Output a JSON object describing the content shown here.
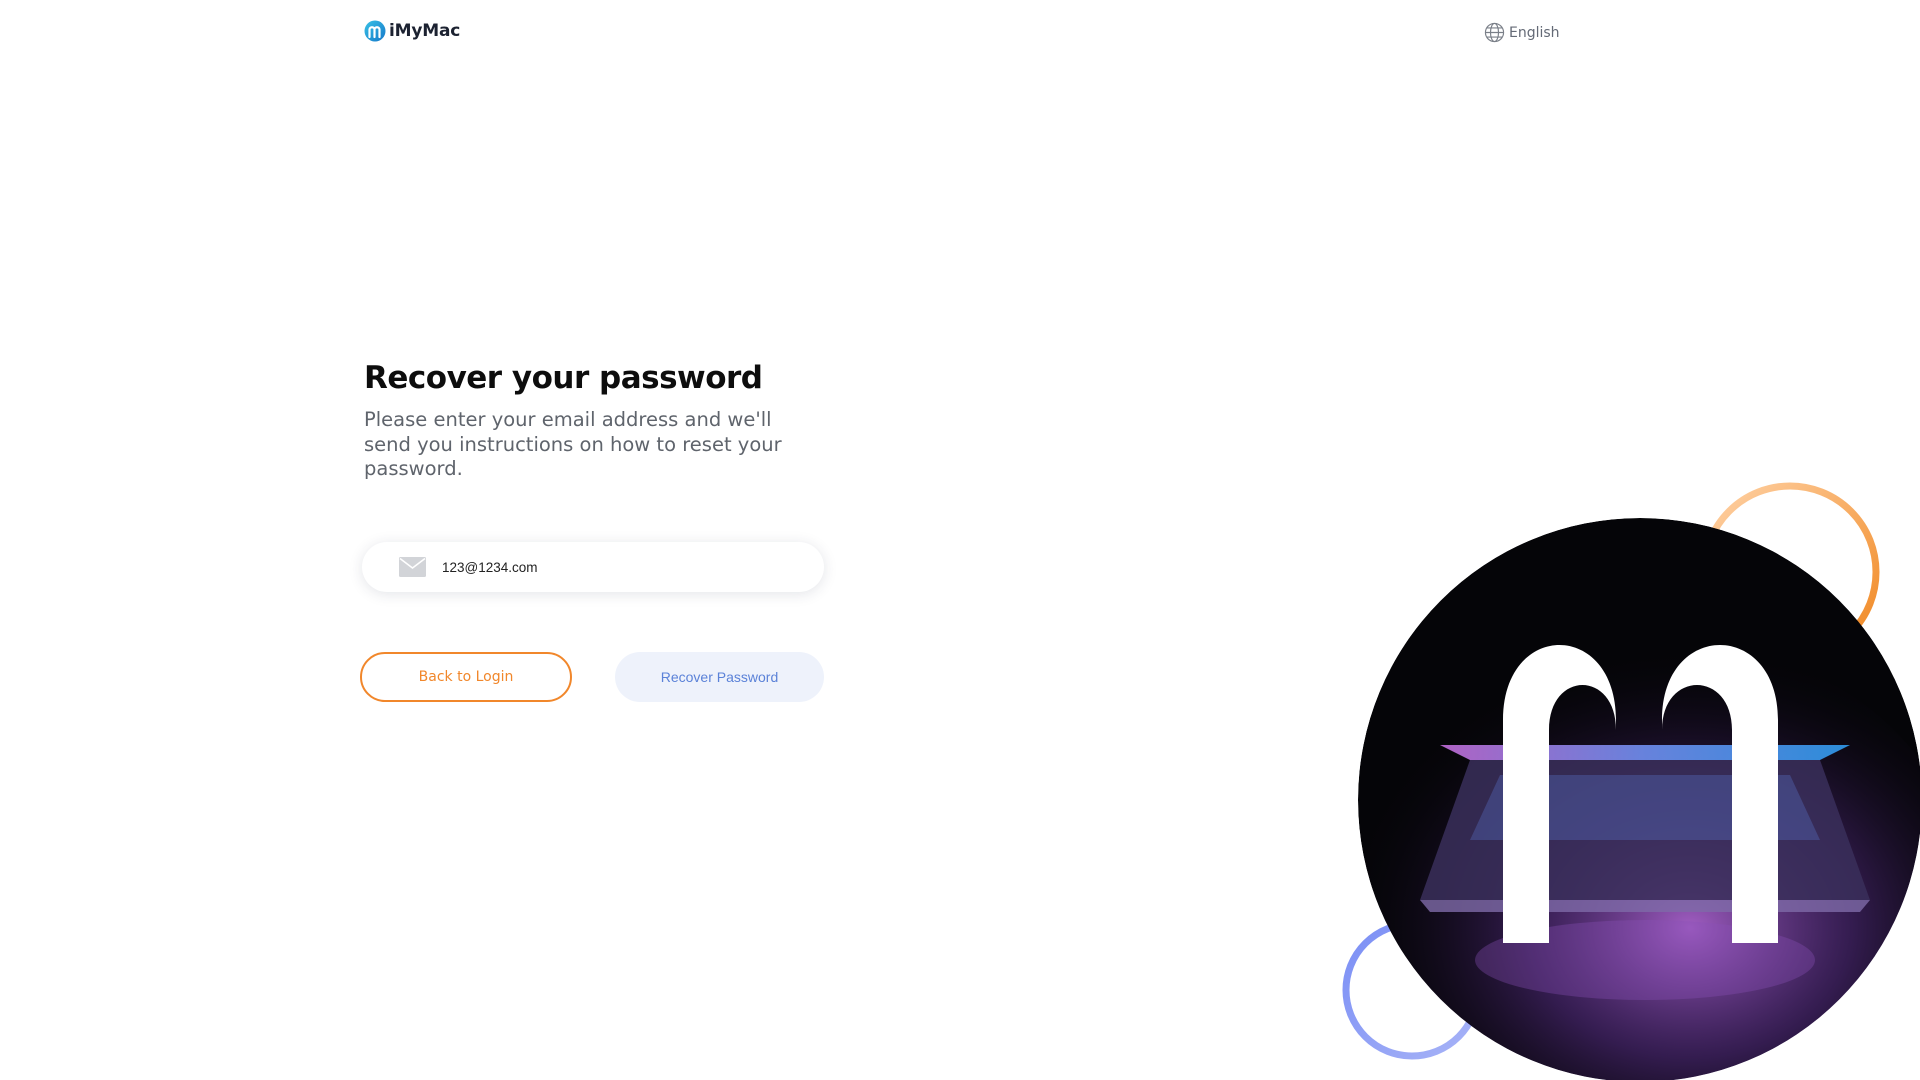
{
  "header": {
    "brand": "iMyMac",
    "language": "English"
  },
  "form": {
    "title": "Recover your password",
    "subtitle": "Please enter your email address and we'll send you instructions on how to reset your password.",
    "email_value": "123@1234.com",
    "back_label": "Back to Login",
    "recover_label": "Recover Password"
  },
  "illustration": {
    "letter": "m"
  },
  "colors": {
    "accent_orange": "#f1872b",
    "accent_blue": "#5b82d8",
    "brand_dark": "#1c2231"
  },
  "icons": {
    "logo": "imymac-logo-icon",
    "language": "globe-icon",
    "email": "mail-icon"
  }
}
